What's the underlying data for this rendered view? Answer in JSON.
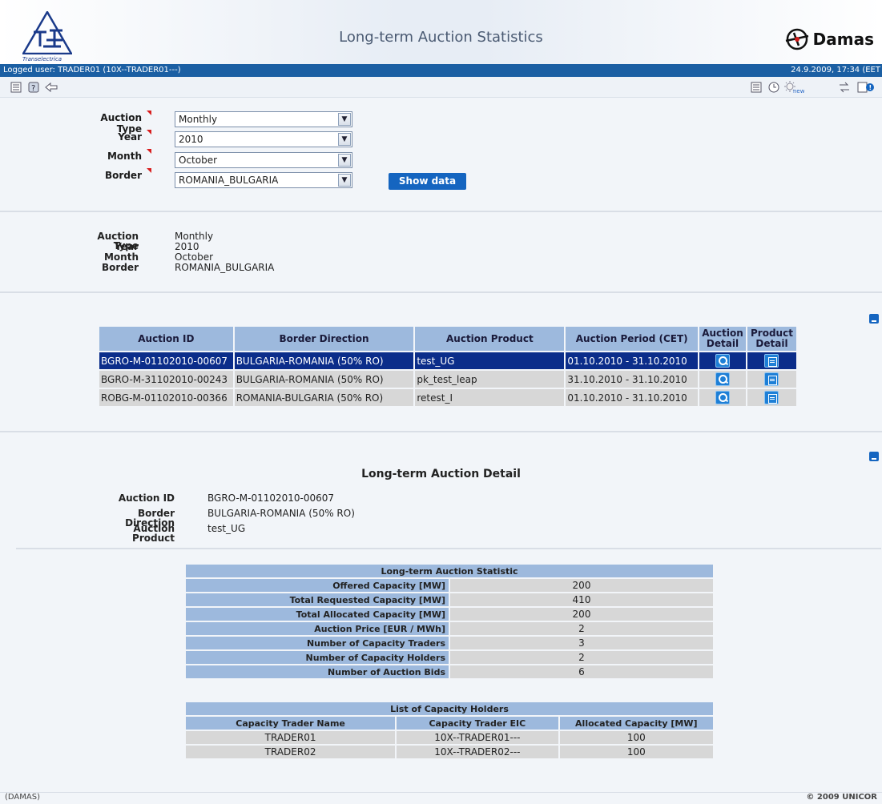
{
  "header": {
    "title": "Long-term Auction Statistics",
    "left_logo_caption": "Transelectrica",
    "right_logo_brand": "Damas"
  },
  "userbar": {
    "logged_user": "Logged user: TRADER01 (10X--TRADER01---)",
    "datetime": "24.9.2009, 17:34  (EET"
  },
  "filters": {
    "auction_type_label": "Auction Type",
    "auction_type_value": "Monthly",
    "year_label": "Year",
    "year_value": "2010",
    "month_label": "Month",
    "month_value": "October",
    "border_label": "Border",
    "border_value": "ROMANIA_BULGARIA",
    "show_button": "Show data"
  },
  "summary": {
    "auction_type_label": "Auction Type",
    "auction_type_value": "Monthly",
    "year_label": "Year",
    "year_value": "2010",
    "month_label": "Month",
    "month_value": "October",
    "border_label": "Border",
    "border_value": "ROMANIA_BULGARIA"
  },
  "auctions": {
    "headers": [
      "Auction ID",
      "Border Direction",
      "Auction Product",
      "Auction Period (CET)",
      "Auction Detail",
      "Product Detail"
    ],
    "rows": [
      {
        "id": "BGRO-M-01102010-00607",
        "direction": "BULGARIA-ROMANIA (50% RO)",
        "product": "test_UG",
        "period": "01.10.2010 - 31.10.2010"
      },
      {
        "id": "BGRO-M-31102010-00243",
        "direction": "BULGARIA-ROMANIA (50% RO)",
        "product": "pk_test_leap",
        "period": "31.10.2010 - 31.10.2010"
      },
      {
        "id": "ROBG-M-01102010-00366",
        "direction": "ROMANIA-BULGARIA (50% RO)",
        "product": "retest_I",
        "period": "01.10.2010 - 31.10.2010"
      }
    ]
  },
  "detail": {
    "title": "Long-term Auction Detail",
    "auction_id_label": "Auction ID",
    "auction_id_value": "BGRO-M-01102010-00607",
    "border_direction_label": "Border Direction",
    "border_direction_value": "BULGARIA-ROMANIA (50% RO)",
    "auction_product_label": "Auction Product",
    "auction_product_value": "test_UG"
  },
  "statistic": {
    "title": "Long-term Auction Statistic",
    "rows": [
      {
        "label": "Offered Capacity [MW]",
        "value": "200"
      },
      {
        "label": "Total Requested Capacity [MW]",
        "value": "410"
      },
      {
        "label": "Total Allocated Capacity [MW]",
        "value": "200"
      },
      {
        "label": "Auction Price [EUR / MWh]",
        "value": "2"
      },
      {
        "label": "Number of Capacity Traders",
        "value": "3"
      },
      {
        "label": "Number of Capacity Holders",
        "value": "2"
      },
      {
        "label": "Number of Auction Bids",
        "value": "6"
      }
    ]
  },
  "holders": {
    "title": "List of Capacity Holders",
    "headers": [
      "Capacity Trader Name",
      "Capacity Trader EIC",
      "Allocated Capacity [MW]"
    ],
    "rows": [
      {
        "name": "TRADER01",
        "eic": "10X--TRADER01---",
        "capacity": "100"
      },
      {
        "name": "TRADER02",
        "eic": "10X--TRADER02---",
        "capacity": "100"
      }
    ]
  },
  "footer": {
    "left": "(DAMAS)",
    "right": "© 2009 UNICOR"
  }
}
